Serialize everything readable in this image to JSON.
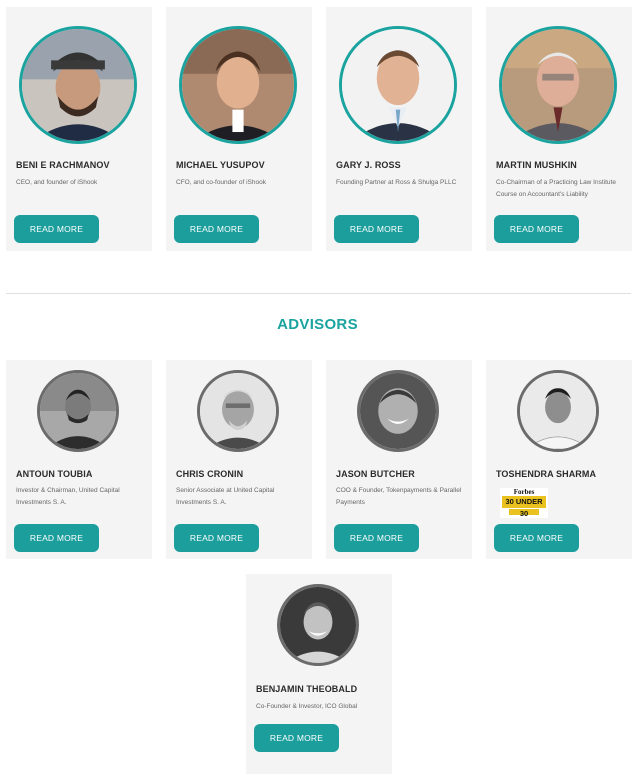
{
  "advisors_heading": "ADVISORS",
  "team": [
    {
      "name": "BENI E RACHMANOV",
      "role": "CEO, and founder of iShook",
      "button": "READ MORE"
    },
    {
      "name": "MICHAEL YUSUPOV",
      "role": "CFO, and co-founder of iShook",
      "button": "READ MORE"
    },
    {
      "name": "GARY J. ROSS",
      "role": "Founding Partner at Ross & Shulga PLLC",
      "button": "READ MORE"
    },
    {
      "name": "MARTIN MUSHKIN",
      "role": "Co-Chairman of a Practicing Law Institute Course on Accountant's Liability",
      "button": "READ MORE"
    }
  ],
  "advisors": [
    {
      "name": "ANTOUN TOUBIA",
      "role": "Investor & Chairman, United Capital Investments S. A.",
      "button": "READ MORE"
    },
    {
      "name": "CHRIS CRONIN",
      "role": "Senior Associate at United Capital Investments S. A.",
      "button": "READ MORE"
    },
    {
      "name": "JASON BUTCHER",
      "role": "COO & Founder, Tokenpayments & Parallel Payments",
      "button": "READ MORE"
    },
    {
      "name": "TOSHENDRA SHARMA",
      "role": "",
      "button": "READ MORE",
      "badge": {
        "line1": "Forbes",
        "line2": "30 UNDER 30"
      }
    },
    {
      "name": "BENJAMIN THEOBALD",
      "role": "Co-Founder & Investor, ICO Global",
      "button": "READ MORE"
    }
  ],
  "colors": {
    "accent": "#1aa39f",
    "button": "#1b9e9c",
    "card_bg": "#f4f4f4"
  }
}
